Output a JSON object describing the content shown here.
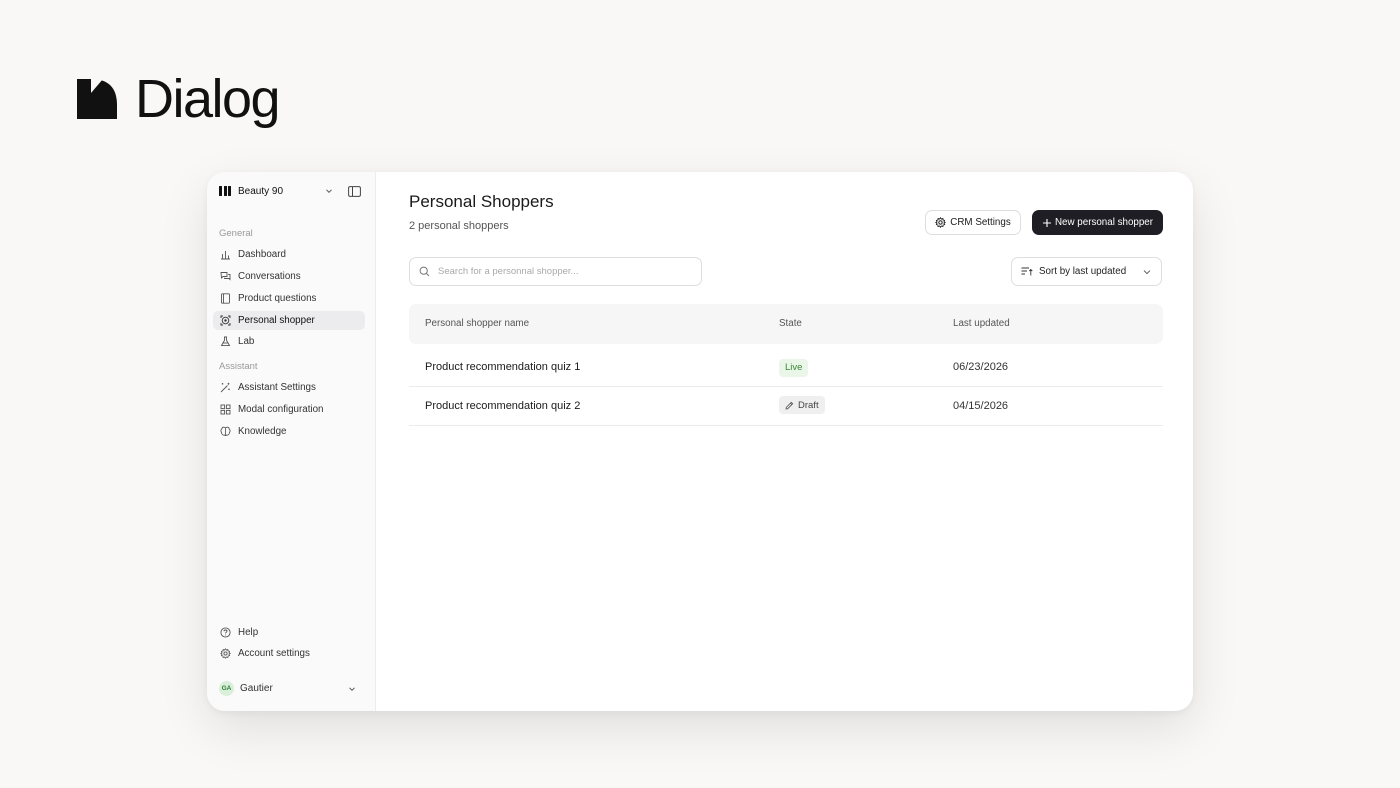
{
  "brand": {
    "name": "Dialog"
  },
  "sidebar": {
    "workspace": {
      "name": "Beauty 90"
    },
    "sections": {
      "general": "General",
      "assistant": "Assistant"
    },
    "general_items": [
      {
        "label": "Dashboard",
        "icon": "bar-chart-icon"
      },
      {
        "label": "Conversations",
        "icon": "chat-bubbles-icon"
      },
      {
        "label": "Product questions",
        "icon": "book-icon"
      },
      {
        "label": "Personal shopper",
        "icon": "shopper-icon",
        "active": true
      },
      {
        "label": "Lab",
        "icon": "flask-icon"
      }
    ],
    "assistant_items": [
      {
        "label": "Assistant Settings",
        "icon": "magic-wand-icon"
      },
      {
        "label": "Modal configuration",
        "icon": "grid-icon"
      },
      {
        "label": "Knowledge",
        "icon": "brain-icon"
      }
    ],
    "footer_items": [
      {
        "label": "Help",
        "icon": "help-circle-icon"
      },
      {
        "label": "Account settings",
        "icon": "gear-icon"
      }
    ],
    "user": {
      "initials": "GA",
      "name": "Gautier"
    }
  },
  "main": {
    "title": "Personal Shoppers",
    "subtitle": "2 personal shoppers",
    "crm_button": "CRM Settings",
    "new_button": "New personal shopper",
    "search": {
      "placeholder": "Search for a personnal shopper..."
    },
    "sort": {
      "label": "Sort by last updated"
    },
    "table": {
      "columns": [
        "Personal shopper name",
        "State",
        "Last updated"
      ],
      "rows": [
        {
          "name": "Product recommendation quiz 1",
          "state": "Live",
          "updated": "06/23/2026"
        },
        {
          "name": "Product recommendation quiz 2",
          "state": "Draft",
          "updated": "04/15/2026"
        }
      ]
    }
  },
  "colors": {
    "primary_button": "#1e1e24",
    "live_badge_bg": "#eaf6e7",
    "live_badge_text": "#3a8a3a",
    "background": "#f9f8f6"
  }
}
